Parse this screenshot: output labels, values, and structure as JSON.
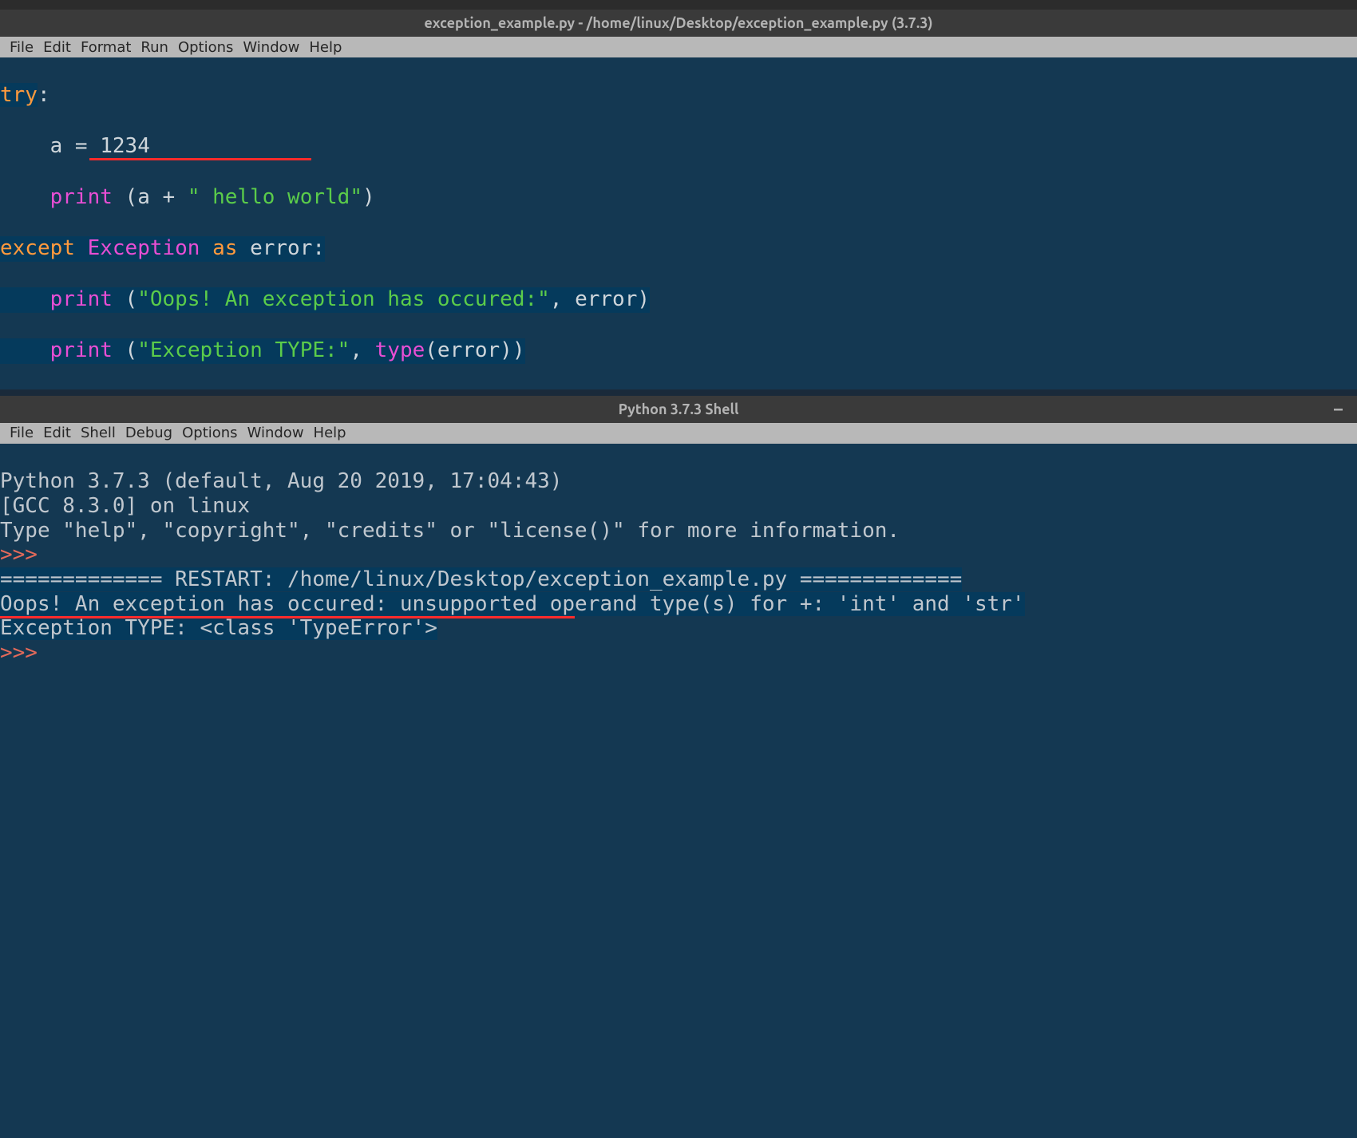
{
  "editor_window": {
    "title": "exception_example.py - /home/linux/Desktop/exception_example.py (3.7.3)",
    "menubar": [
      "File",
      "Edit",
      "Format",
      "Run",
      "Options",
      "Window",
      "Help"
    ]
  },
  "code": {
    "l1_try": "try",
    "l1_colon": ":",
    "l2_indent": "    ",
    "l2_ident": "a = ",
    "l2_num": "1234",
    "l3_indent": "    ",
    "l3_print": "print",
    "l3_rest1": " (a + ",
    "l3_str": "\" hello world\"",
    "l3_rest2": ")",
    "l4_except": "except",
    "l4_sp1": " ",
    "l4_exception": "Exception",
    "l4_sp2": " ",
    "l4_as": "as",
    "l4_sp3": " ",
    "l4_err": "error",
    "l4_colon": ":",
    "l5_indent": "    ",
    "l5_print": "print",
    "l5_rest1": " (",
    "l5_str": "\"Oops! An exception has occured:\"",
    "l5_rest2": ", error)",
    "l6_indent": "    ",
    "l6_print": "print",
    "l6_rest1": " (",
    "l6_str": "\"Exception TYPE:\"",
    "l6_rest2": ", ",
    "l6_type": "type",
    "l6_rest3": "(error))"
  },
  "shell_window": {
    "title": "Python 3.7.3 Shell",
    "menubar": [
      "File",
      "Edit",
      "Shell",
      "Debug",
      "Options",
      "Window",
      "Help"
    ]
  },
  "shell_output": {
    "banner1": "Python 3.7.3 (default, Aug 20 2019, 17:04:43) ",
    "banner2": "[GCC 8.3.0] on linux",
    "banner3": "Type \"help\", \"copyright\", \"credits\" or \"license()\" for more information.",
    "prompt": ">>> ",
    "restart": "============= RESTART: /home/linux/Desktop/exception_example.py =============",
    "out1": "Oops! An exception has occured: unsupported operand type(s) for +: 'int' and 'str'",
    "out2": "Exception TYPE: <class 'TypeError'>",
    "prompt2": ">>> "
  }
}
